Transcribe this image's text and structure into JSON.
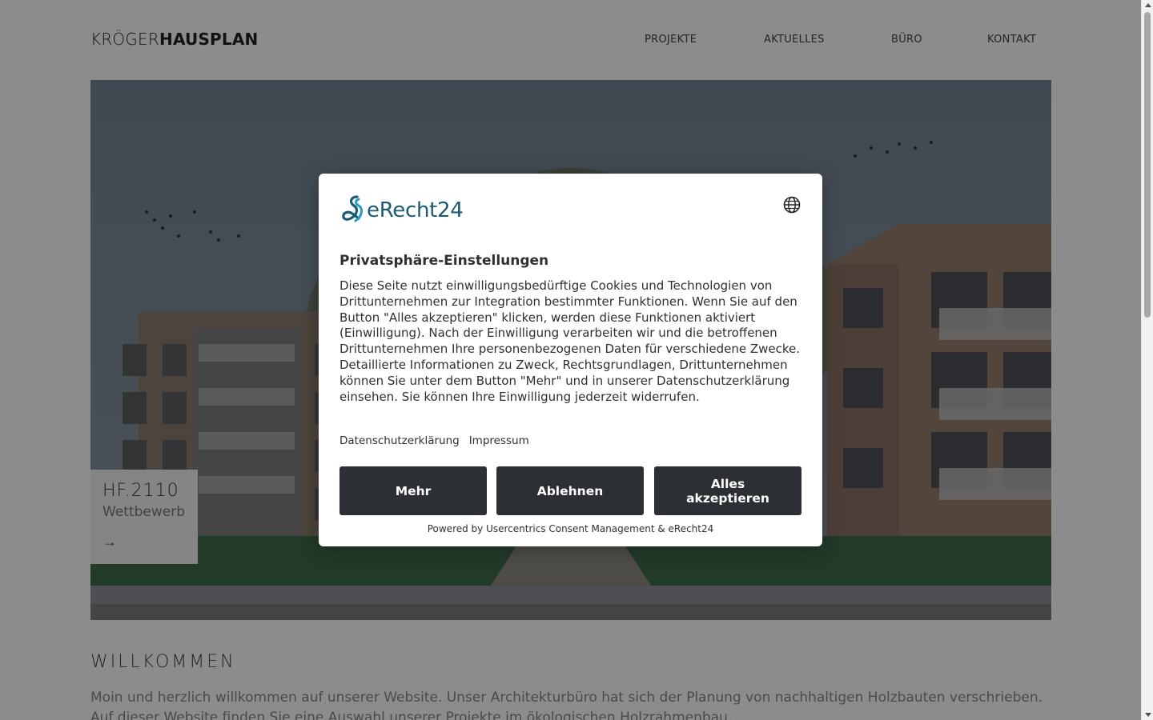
{
  "header": {
    "logo_light": "KRÖGER",
    "logo_bold": "HAUSPLAN",
    "nav": [
      "PROJEKTE",
      "AKTUELLES",
      "BÜRO",
      "KONTAKT"
    ]
  },
  "hero": {
    "project_code": "HF.2110",
    "project_subtitle": "Wettbewerb",
    "arrow_icon": "arrow-right-icon"
  },
  "welcome": {
    "title": "WILLKOMMEN",
    "text": "Moin und herzlich willkommen auf unserer Website. Unser Architekturbüro hat sich der Planung von nachhaltigen Holzbauten verschrieben. Auf dieser Website finden Sie eine Auswahl unserer Projekte im ökologischen Holzrahmenbau."
  },
  "consent": {
    "brand": "eRecht24",
    "title": "Privatsphäre-Einstellungen",
    "body": "Diese Seite nutzt einwilligungsbedürftige Cookies und Technologien von Drittunternehmen zur Integration bestimmter Funktionen. Wenn Sie auf den Button \"Alles akzeptieren\" klicken, werden diese Funktionen aktiviert (Einwilligung). Nach der Einwilligung verarbeiten wir und die betroffenen Drittunternehmen Ihre personenbezogenen Daten für verschiedene Zwecke. Detaillierte Informationen zu Zweck, Rechtsgrundlagen, Drittunternehmen können Sie unter dem Button \"Mehr\" und in unserer Datenschutzerklärung einsehen. Sie können Ihre Einwilligung jederzeit widerrufen.",
    "links": [
      "Datenschutzerklärung",
      "Impressum"
    ],
    "buttons": {
      "more": "Mehr",
      "reject": "Ablehnen",
      "accept": "Alles akzeptieren"
    },
    "powered_by": "Powered by Usercentrics Consent Management & eRecht24",
    "language_icon": "globe-icon"
  },
  "colors": {
    "button_bg": "#2c2f33",
    "brand_teal": "#1d5b75",
    "brand_cyan": "#1f9fc4"
  }
}
